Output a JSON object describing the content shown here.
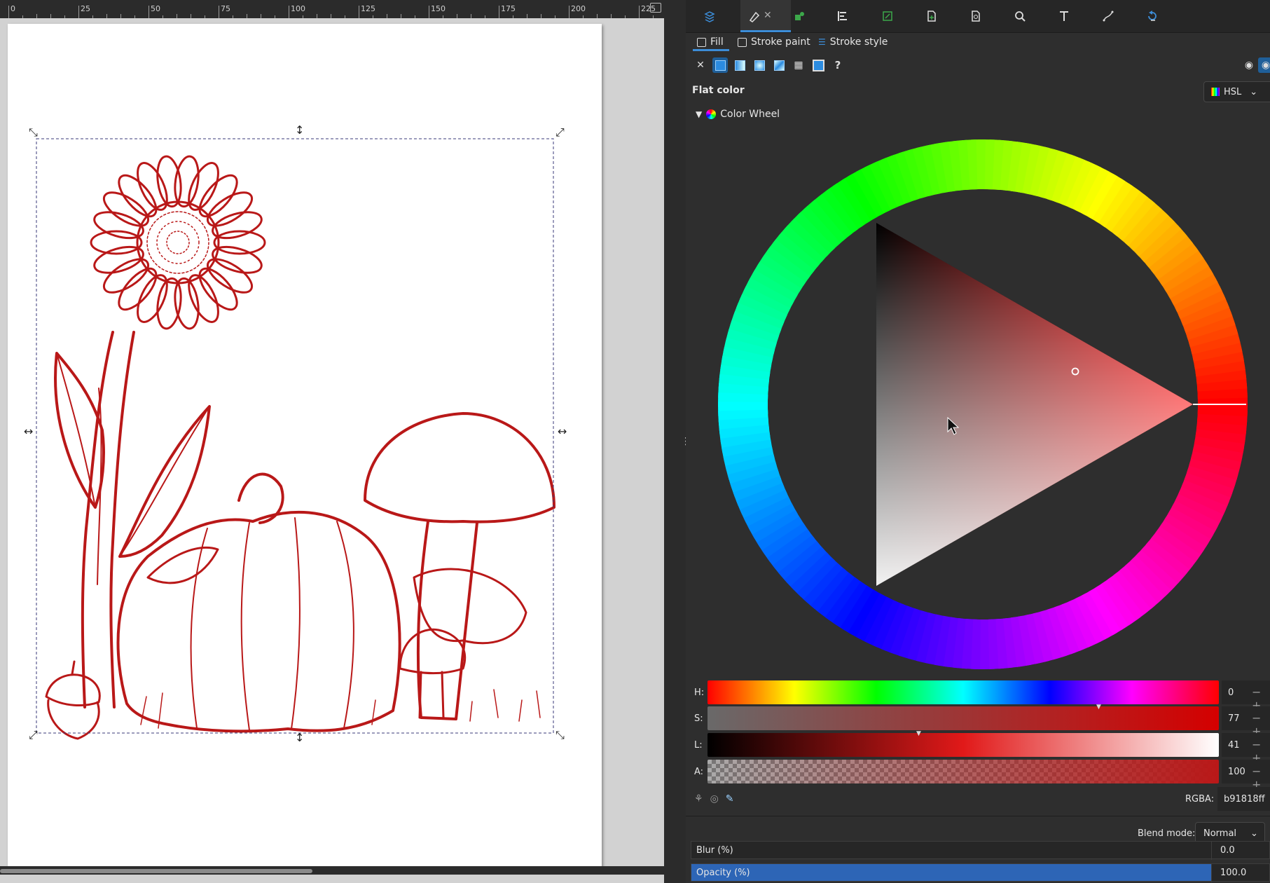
{
  "ruler": {
    "labels": [
      "0",
      "25",
      "50",
      "75",
      "100",
      "125",
      "150",
      "175",
      "200",
      "225"
    ]
  },
  "dock": {
    "buttons": [
      "layers-icon",
      "fill-stroke-icon",
      "object-icon",
      "align-icon",
      "export-icon",
      "document-properties-icon",
      "symbols-icon",
      "search-icon",
      "text-icon",
      "path-effects-icon",
      "undo-history-icon"
    ],
    "active_tab": "Fill and Stroke"
  },
  "subtabs": {
    "fill": "Fill",
    "stroke_paint": "Stroke paint",
    "stroke_style": "Stroke style"
  },
  "paint_types": [
    "no-paint",
    "flat-color",
    "linear-gradient",
    "radial-gradient",
    "mesh-gradient",
    "pattern",
    "swatch",
    "unset"
  ],
  "fill": {
    "title": "Flat color",
    "mode": "HSL",
    "wheel_label": "Color Wheel",
    "sliders": [
      {
        "key": "H",
        "label": "H:",
        "value": "0"
      },
      {
        "key": "S",
        "label": "S:",
        "value": "77"
      },
      {
        "key": "L",
        "label": "L:",
        "value": "41"
      },
      {
        "key": "A",
        "label": "A:",
        "value": "100"
      }
    ],
    "rgba_label": "RGBA:",
    "rgba_value": "b91818ff",
    "blend_label": "Blend mode:",
    "blend_value": "Normal",
    "blur_label": "Blur (%)",
    "blur_value": "0.0",
    "opacity_label": "Opacity (%)",
    "opacity_value": "100.0"
  },
  "colors": {
    "stroke": "#b91818",
    "panel": "#2e2e2e",
    "accent": "#3c8dd8"
  }
}
